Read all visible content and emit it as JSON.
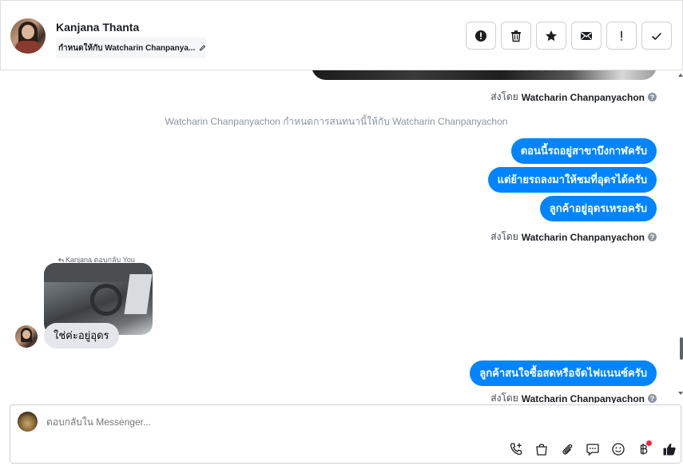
{
  "header": {
    "contact_name": "Kanjana Thanta",
    "assignment_text": "กำหนดให้กับ Watcharin Chanpanya...",
    "actions": [
      {
        "icon": "alert-circle-icon",
        "label": "spam"
      },
      {
        "icon": "trash-icon",
        "label": "delete"
      },
      {
        "icon": "star-icon",
        "label": "star"
      },
      {
        "icon": "envelope-icon",
        "label": "mark-unread"
      },
      {
        "icon": "exclamation-icon",
        "label": "follow-up"
      },
      {
        "icon": "checkmark-icon",
        "label": "done"
      }
    ]
  },
  "chat": {
    "sent_by_prefix": "ส่งโดย",
    "sender_name": "Watcharin Chanpanyachon",
    "help_glyph": "?",
    "system_message": "Watcharin Chanpanyachon กำหนดการสนทนานี้ให้กับ Watcharin Chanpanyachon",
    "outgoing_group_1": [
      "ตอนนี้รถอยู่สาขาบึงกาฬครับ",
      "แต่ย้ายรถลงมาให้ชมที่อุดรได้ครับ",
      "ลูกค้าอยู่อุดรเหรอครับ"
    ],
    "reply_label": "Kanjana ตอบกลับ You",
    "incoming_message": "ใช่ค่ะอยู่อุดร",
    "outgoing_group_2": [
      "ลูกค้าสนใจซื้อสดหรือจัดไฟแนนซ์ครับ"
    ]
  },
  "composer": {
    "placeholder": "ตอบกลับใน Messenger...",
    "icons": [
      "phone-plus-icon",
      "shopping-bag-icon",
      "paperclip-icon",
      "chat-bubble-icon",
      "smiley-icon",
      "baht-icon",
      "thumbs-up-icon"
    ]
  },
  "colors": {
    "accent": "#0084ff",
    "incoming_bubble": "#e4e6eb",
    "notification_dot": "#f02849"
  }
}
